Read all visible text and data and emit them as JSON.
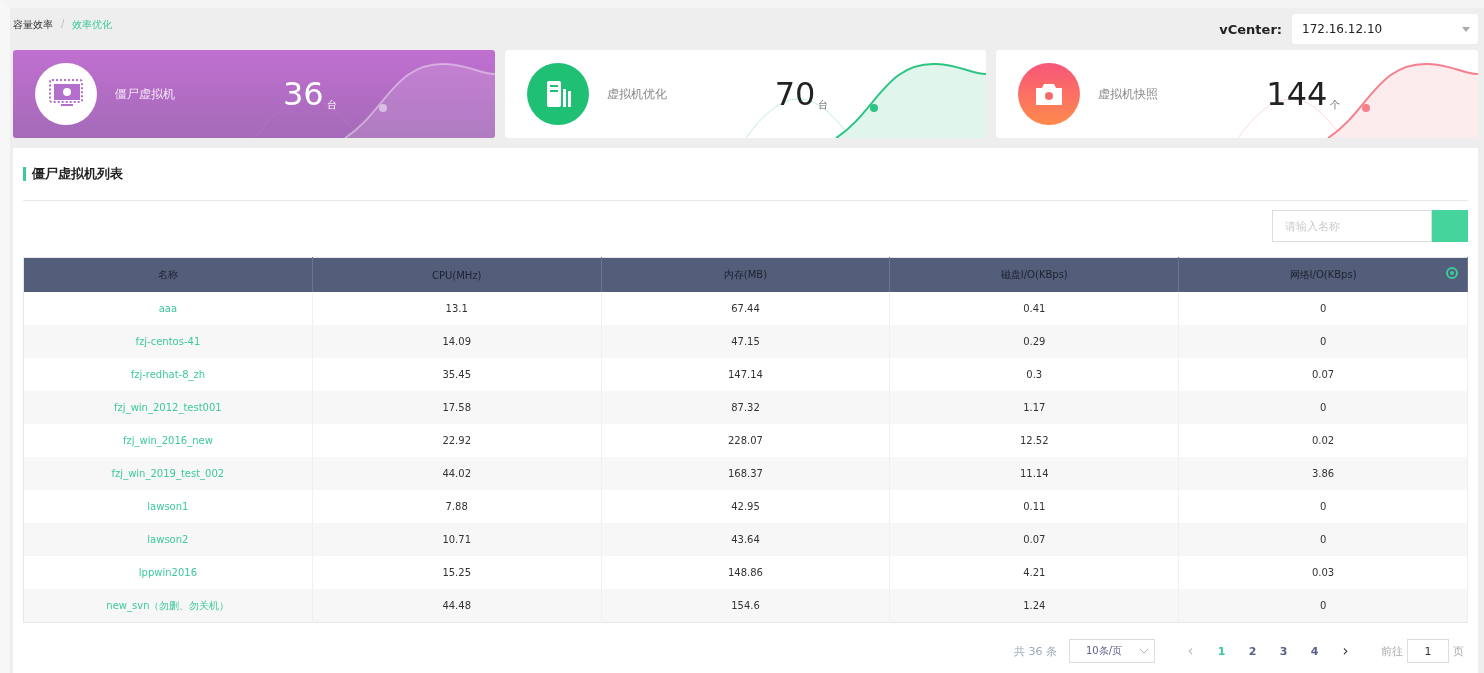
{
  "breadcrumb": [
    {
      "label": "容量效率",
      "selected": false
    },
    {
      "label": "效率优化",
      "selected": true
    }
  ],
  "breadcrumb_separator": "/",
  "vcenter": {
    "label": "vCenter:",
    "value": "172.16.12.10"
  },
  "cards": [
    {
      "kind": "monitor",
      "title": "僵尸虚拟机",
      "value": "36",
      "unit": "台",
      "selected": true
    },
    {
      "kind": "server",
      "title": "虚拟机优化",
      "value": "70",
      "unit": "台",
      "selected": false
    },
    {
      "kind": "camera",
      "title": "虚拟机快照",
      "value": "144",
      "unit": "个",
      "selected": false
    }
  ],
  "section_title": "僵尸虚拟机列表",
  "search": {
    "placeholder": "请输入名称"
  },
  "table": {
    "columns": [
      "名称",
      "CPU(MHz)",
      "内存(MB)",
      "磁盘I/O(KBps)",
      "网络I/O(KBps)"
    ],
    "rows": [
      [
        "aaa",
        "13.1",
        "67.44",
        "0.41",
        "0"
      ],
      [
        "fzj-centos-41",
        "14.09",
        "47.15",
        "0.29",
        "0"
      ],
      [
        "fzj-redhat-8_zh",
        "35.45",
        "147.14",
        "0.3",
        "0.07"
      ],
      [
        "fzj_win_2012_test001",
        "17.58",
        "87.32",
        "1.17",
        "0"
      ],
      [
        "fzj_win_2016_new",
        "22.92",
        "228.07",
        "12.52",
        "0.02"
      ],
      [
        "fzj_win_2019_test_002",
        "44.02",
        "168.37",
        "11.14",
        "3.86"
      ],
      [
        "lawson1",
        "7.88",
        "42.95",
        "0.11",
        "0"
      ],
      [
        "lawson2",
        "10.71",
        "43.64",
        "0.07",
        "0"
      ],
      [
        "lppwin2016",
        "15.25",
        "148.86",
        "4.21",
        "0.03"
      ],
      [
        "new_svn（勿删、勿关机）",
        "44.48",
        "154.6",
        "1.24",
        "0"
      ]
    ]
  },
  "pagination": {
    "total": "共 36 条",
    "page_size": "10条/页",
    "prev": "‹",
    "next": "›",
    "pages": [
      {
        "label": "1",
        "selected": true
      },
      {
        "label": "2",
        "selected": false
      },
      {
        "label": "3",
        "selected": false
      },
      {
        "label": "4",
        "selected": false
      }
    ],
    "goto_label": "前往",
    "goto_value": "1",
    "goto_suffix": "页"
  }
}
